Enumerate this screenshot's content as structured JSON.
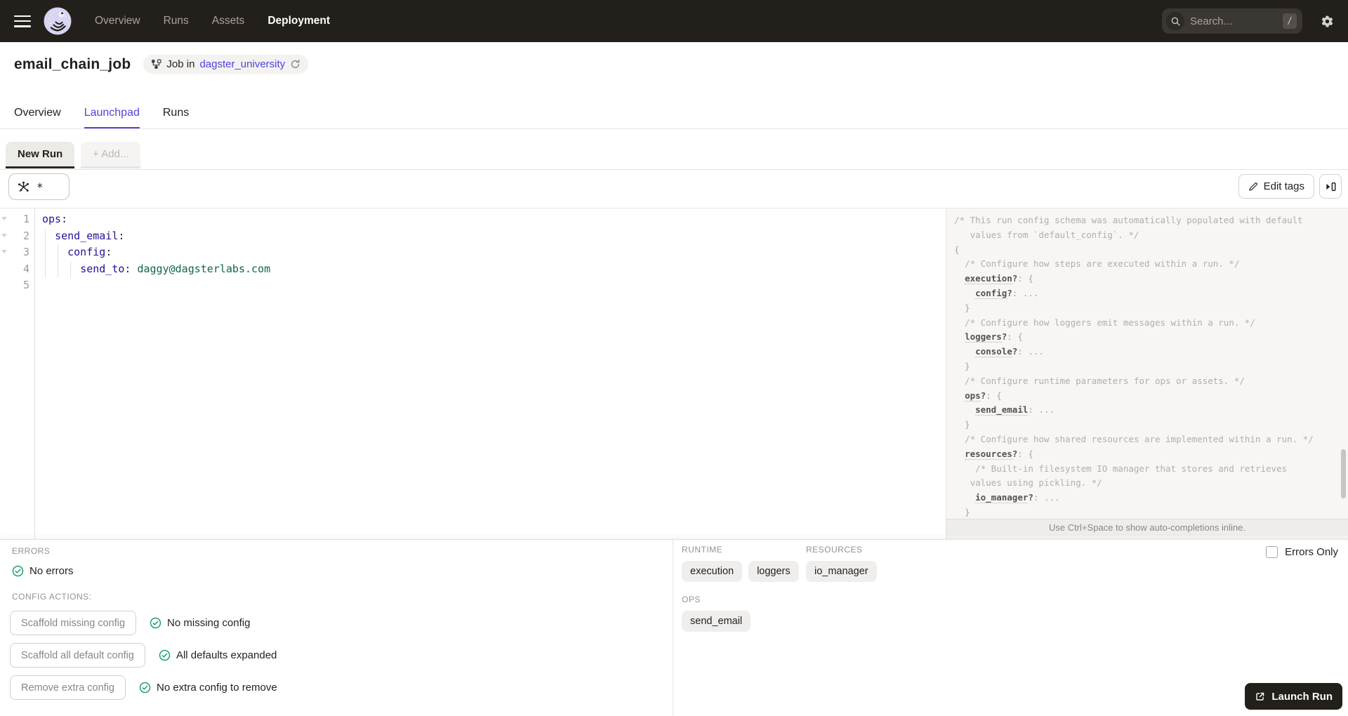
{
  "nav": {
    "menu_items": [
      {
        "label": "Overview",
        "active": false
      },
      {
        "label": "Runs",
        "active": false
      },
      {
        "label": "Assets",
        "active": false
      },
      {
        "label": "Deployment",
        "active": true
      }
    ],
    "search": {
      "placeholder": "Search...",
      "shortcut": "/"
    }
  },
  "header": {
    "title": "email_chain_job",
    "badge": {
      "prefix": "Job in",
      "link": "dagster_university"
    }
  },
  "tabs": [
    {
      "label": "Overview",
      "active": false
    },
    {
      "label": "Launchpad",
      "active": true
    },
    {
      "label": "Runs",
      "active": false
    }
  ],
  "subtabs": [
    {
      "label": "New Run",
      "active": true
    },
    {
      "label": "+ Add...",
      "active": false
    }
  ],
  "toolbar": {
    "op_selector_value": "*",
    "edit_tags_label": "Edit tags"
  },
  "editor": {
    "gutter": [
      "1",
      "2",
      "3",
      "4",
      "5"
    ],
    "lines": [
      [
        {
          "t": "k",
          "s": "ops"
        },
        {
          "t": "p",
          "s": ":"
        }
      ],
      [
        {
          "t": "w",
          "s": "  "
        },
        {
          "t": "k",
          "s": "send_email"
        },
        {
          "t": "p",
          "s": ":"
        }
      ],
      [
        {
          "t": "w",
          "s": "    "
        },
        {
          "t": "k",
          "s": "config"
        },
        {
          "t": "p",
          "s": ":"
        }
      ],
      [
        {
          "t": "w",
          "s": "      "
        },
        {
          "t": "k",
          "s": "send_to"
        },
        {
          "t": "p",
          "s": ": "
        },
        {
          "t": "v",
          "s": "daggy@dagsterlabs.com"
        }
      ],
      []
    ]
  },
  "schema": {
    "hint": "Use Ctrl+Space to show auto-completions inline.",
    "lines": [
      [
        {
          "t": "c",
          "s": "/* This run config schema was automatically populated with default"
        }
      ],
      [
        {
          "t": "c",
          "s": "   values from `default_config`. */"
        }
      ],
      [
        {
          "t": "p",
          "s": "{"
        }
      ],
      [
        {
          "t": "c",
          "s": "  /* Configure how steps are executed within a run. */"
        }
      ],
      [
        {
          "t": "p",
          "s": "  "
        },
        {
          "t": "k",
          "s": "execution"
        },
        {
          "t": "d",
          "s": "?"
        },
        {
          "t": "p",
          "s": ": {"
        }
      ],
      [
        {
          "t": "p",
          "s": "    "
        },
        {
          "t": "k",
          "s": "config"
        },
        {
          "t": "d",
          "s": "?"
        },
        {
          "t": "p",
          "s": ": ..."
        }
      ],
      [
        {
          "t": "p",
          "s": "  }"
        }
      ],
      [
        {
          "t": "c",
          "s": "  /* Configure how loggers emit messages within a run. */"
        }
      ],
      [
        {
          "t": "p",
          "s": "  "
        },
        {
          "t": "k",
          "s": "loggers"
        },
        {
          "t": "d",
          "s": "?"
        },
        {
          "t": "p",
          "s": ": {"
        }
      ],
      [
        {
          "t": "p",
          "s": "    "
        },
        {
          "t": "k",
          "s": "console"
        },
        {
          "t": "d",
          "s": "?"
        },
        {
          "t": "p",
          "s": ": ..."
        }
      ],
      [
        {
          "t": "p",
          "s": "  }"
        }
      ],
      [
        {
          "t": "c",
          "s": "  /* Configure runtime parameters for ops or assets. */"
        }
      ],
      [
        {
          "t": "p",
          "s": "  "
        },
        {
          "t": "k",
          "s": "ops"
        },
        {
          "t": "d",
          "s": "?"
        },
        {
          "t": "p",
          "s": ": {"
        }
      ],
      [
        {
          "t": "p",
          "s": "    "
        },
        {
          "t": "k",
          "s": "send_email"
        },
        {
          "t": "p",
          "s": ": ..."
        }
      ],
      [
        {
          "t": "p",
          "s": "  }"
        }
      ],
      [
        {
          "t": "c",
          "s": "  /* Configure how shared resources are implemented within a run. */"
        }
      ],
      [
        {
          "t": "p",
          "s": "  "
        },
        {
          "t": "k",
          "s": "resources"
        },
        {
          "t": "d",
          "s": "?"
        },
        {
          "t": "p",
          "s": ": {"
        }
      ],
      [
        {
          "t": "c",
          "s": "    /* Built-in filesystem IO manager that stores and retrieves"
        }
      ],
      [
        {
          "t": "c",
          "s": "   values using pickling. */"
        }
      ],
      [
        {
          "t": "p",
          "s": "    "
        },
        {
          "t": "k",
          "s": "io_manager"
        },
        {
          "t": "d",
          "s": "?"
        },
        {
          "t": "p",
          "s": ": ..."
        }
      ],
      [
        {
          "t": "p",
          "s": "  }"
        }
      ]
    ]
  },
  "panels": {
    "errors": {
      "heading": "ERRORS",
      "status": "No errors"
    },
    "config_actions": {
      "heading": "CONFIG ACTIONS:",
      "rows": [
        {
          "button": "Scaffold missing config",
          "status": "No missing config"
        },
        {
          "button": "Scaffold all default config",
          "status": "All defaults expanded"
        },
        {
          "button": "Remove extra config",
          "status": "No extra config to remove"
        }
      ]
    },
    "runtime": {
      "heading": "RUNTIME",
      "tags": [
        "execution",
        "loggers"
      ]
    },
    "resources": {
      "heading": "RESOURCES",
      "tags": [
        "io_manager"
      ]
    },
    "ops": {
      "heading": "OPS",
      "tags": [
        "send_email"
      ]
    },
    "errors_only": {
      "label": "Errors Only",
      "checked": false
    },
    "launch": {
      "label": "Launch Run"
    }
  },
  "colors": {
    "nav_bg": "#231F1B",
    "accent_blurple": "#4F43DD",
    "status_green": "#21A168",
    "editor_key": "#221199",
    "editor_value": "#116644"
  }
}
